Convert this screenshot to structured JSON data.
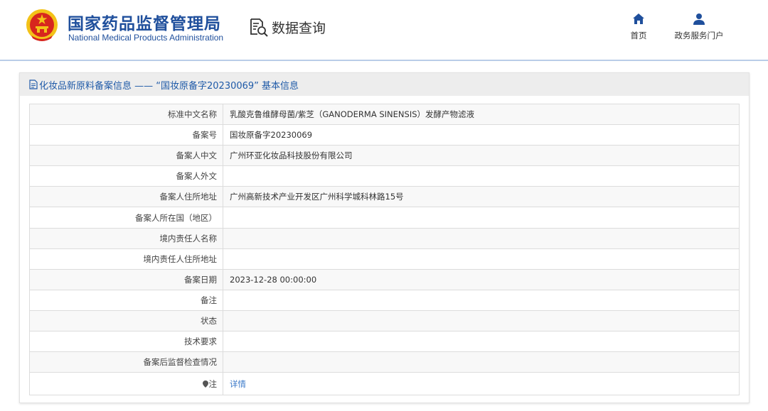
{
  "header": {
    "logo_cn": "国家药品监督管理局",
    "logo_en": "National Medical Products Administration",
    "data_query_label": "数据查询",
    "nav": {
      "home_label": "首页",
      "portal_label": "政务服务门户"
    }
  },
  "panel": {
    "title": "化妆品新原料备案信息 —— “国妆原备字20230069” 基本信息"
  },
  "table": {
    "rows": [
      {
        "label": "标准中文名称",
        "value": "乳酸克鲁维酵母菌/紫芝（GANODERMA SINENSIS）发酵产物滤液"
      },
      {
        "label": "备案号",
        "value": "国妆原备字20230069"
      },
      {
        "label": "备案人中文",
        "value": "广州环亚化妆品科技股份有限公司"
      },
      {
        "label": "备案人外文",
        "value": ""
      },
      {
        "label": "备案人住所地址",
        "value": "广州高新技术产业开发区广州科学城科林路15号"
      },
      {
        "label": "备案人所在国（地区）",
        "value": ""
      },
      {
        "label": "境内责任人名称",
        "value": ""
      },
      {
        "label": "境内责任人住所地址",
        "value": ""
      },
      {
        "label": "备案日期",
        "value": "2023-12-28 00:00:00"
      },
      {
        "label": "备注",
        "value": ""
      },
      {
        "label": "状态",
        "value": ""
      },
      {
        "label": "技术要求",
        "value": ""
      },
      {
        "label": "备案后监督检查情况",
        "value": ""
      }
    ],
    "note_label": "注",
    "note_link": "详情"
  },
  "colors": {
    "brand_blue": "#1f4f9c",
    "link_blue": "#3a78c8",
    "emblem_red": "#d7261e",
    "emblem_gold": "#f3c218"
  },
  "icons": [
    "national-emblem-icon",
    "data-query-icon",
    "home-icon",
    "user-icon",
    "document-icon",
    "pin-icon"
  ]
}
